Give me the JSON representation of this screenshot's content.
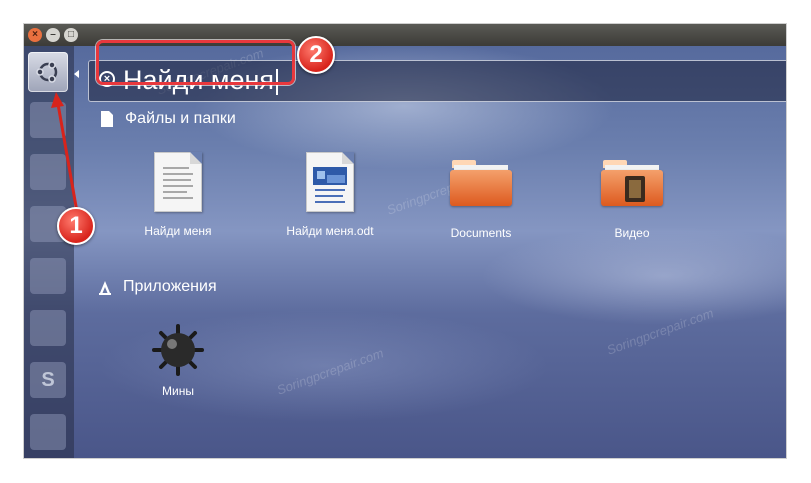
{
  "window": {
    "controls": [
      "close-icon",
      "minimize-icon",
      "maximize-icon"
    ]
  },
  "launcher": {
    "home_icon": "ubuntu-logo-icon",
    "items": [
      {
        "icon": "files-icon"
      },
      {
        "icon": "browser-icon"
      },
      {
        "icon": "writer-icon"
      },
      {
        "icon": "calc-icon"
      },
      {
        "icon": "impress-icon"
      },
      {
        "icon": "software-center-icon",
        "glyph": "S"
      },
      {
        "icon": "system-settings-icon"
      }
    ]
  },
  "search": {
    "value": "Найди меня",
    "clear_icon": "clear-search-icon"
  },
  "categories": {
    "files": {
      "label": "Файлы и папки",
      "icon": "file-icon",
      "results": [
        {
          "label": "Найди меня",
          "icon": "text-document-icon"
        },
        {
          "label": "Найди меня.odt",
          "icon": "odt-document-icon"
        },
        {
          "label": "Documents",
          "icon": "folder-icon"
        },
        {
          "label": "Видео",
          "icon": "video-folder-icon"
        }
      ]
    },
    "apps": {
      "label": "Приложения",
      "icon": "applications-icon",
      "results": [
        {
          "label": "Мины",
          "icon": "mines-icon"
        }
      ]
    }
  },
  "annotations": {
    "badge_1": "1",
    "badge_2": "2",
    "accent_color": "#e8383d"
  }
}
